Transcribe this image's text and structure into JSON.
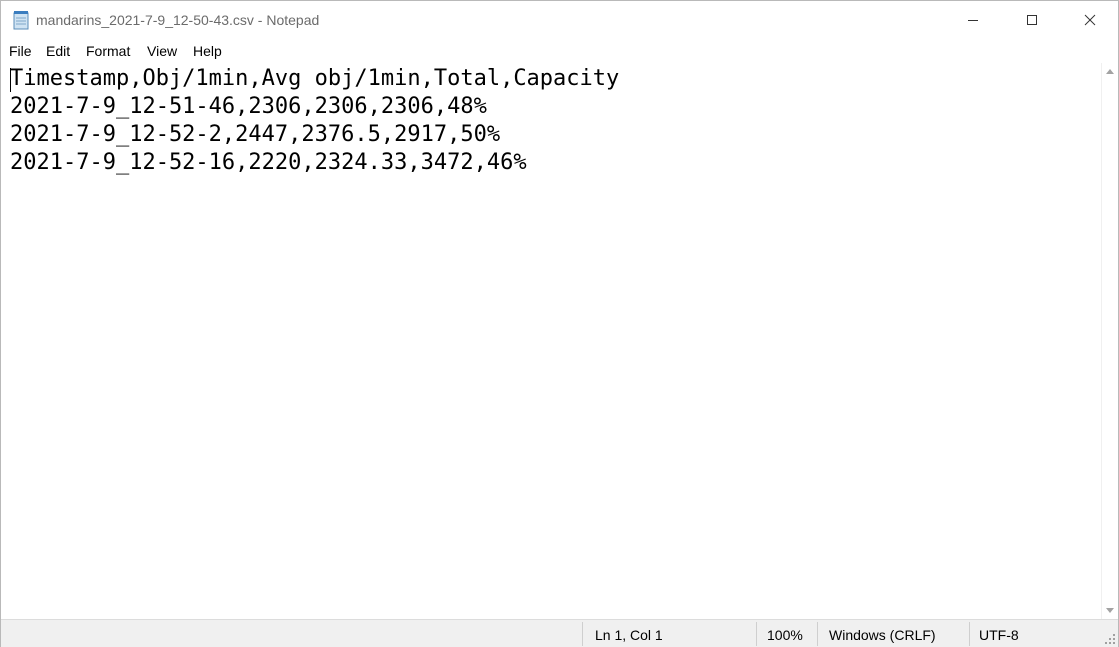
{
  "window": {
    "title": "mandarins_2021-7-9_12-50-43.csv - Notepad",
    "icon": "notepad-icon"
  },
  "menu": {
    "items": [
      "File",
      "Edit",
      "Format",
      "View",
      "Help"
    ]
  },
  "editor": {
    "lines": [
      "Timestamp,Obj/1min,Avg obj/1min,Total,Capacity",
      "2021-7-9_12-51-46,2306,2306,2306,48%",
      "2021-7-9_12-52-2,2447,2376.5,2917,50%",
      "2021-7-9_12-52-16,2220,2324.33,3472,46%"
    ]
  },
  "status": {
    "position": "Ln 1, Col 1",
    "zoom": "100%",
    "line_ending": "Windows (CRLF)",
    "encoding": "UTF-8"
  },
  "colors": {
    "title_text": "#6b6b6b",
    "status_bg": "#f0f0f0"
  }
}
